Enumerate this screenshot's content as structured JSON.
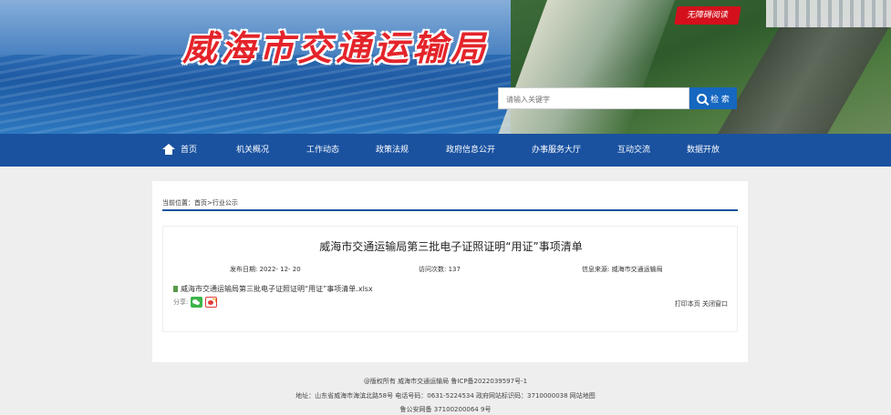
{
  "header": {
    "site_title": "威海市交通运输局",
    "accessibility_label": "无障碍阅读",
    "search": {
      "placeholder": "请输入关键字",
      "button_label": "检 索"
    }
  },
  "nav": {
    "items": [
      {
        "label": "首页",
        "icon": "home-icon"
      },
      {
        "label": "机关概况"
      },
      {
        "label": "工作动态"
      },
      {
        "label": "政策法规"
      },
      {
        "label": "政府信息公开"
      },
      {
        "label": "办事服务大厅"
      },
      {
        "label": "互动交流"
      },
      {
        "label": "数据开放"
      }
    ]
  },
  "breadcrumb": "当前位置：首页>行业公示",
  "article": {
    "title": "威海市交通运输局第三批电子证照证明“用证”事项清单",
    "publish_date": "发布日期:    2022- 12- 20",
    "visits": "访问次数:    137",
    "source": "信息来源:    威海市交通运输局",
    "attachment": "威海市交通运输局第三批电子证照证明“用证”事项清单.xlsx",
    "share_label": "分享:",
    "print_label": "打印本页",
    "close_label": "关闭窗口"
  },
  "footer": {
    "line1": "@版权所有 威海市交通运输局 鲁ICP备2022039597号-1",
    "line2": "地址：山东省威海市海滨北路58号 电话号码：0631-5224534 政府网站标识码：3710000038 网站地图",
    "line3": "鲁公安网备 37100200064 9号"
  },
  "colors": {
    "nav_bg": "#1a52a0",
    "title_red": "#e4242a",
    "search_btn": "#1667c0"
  }
}
